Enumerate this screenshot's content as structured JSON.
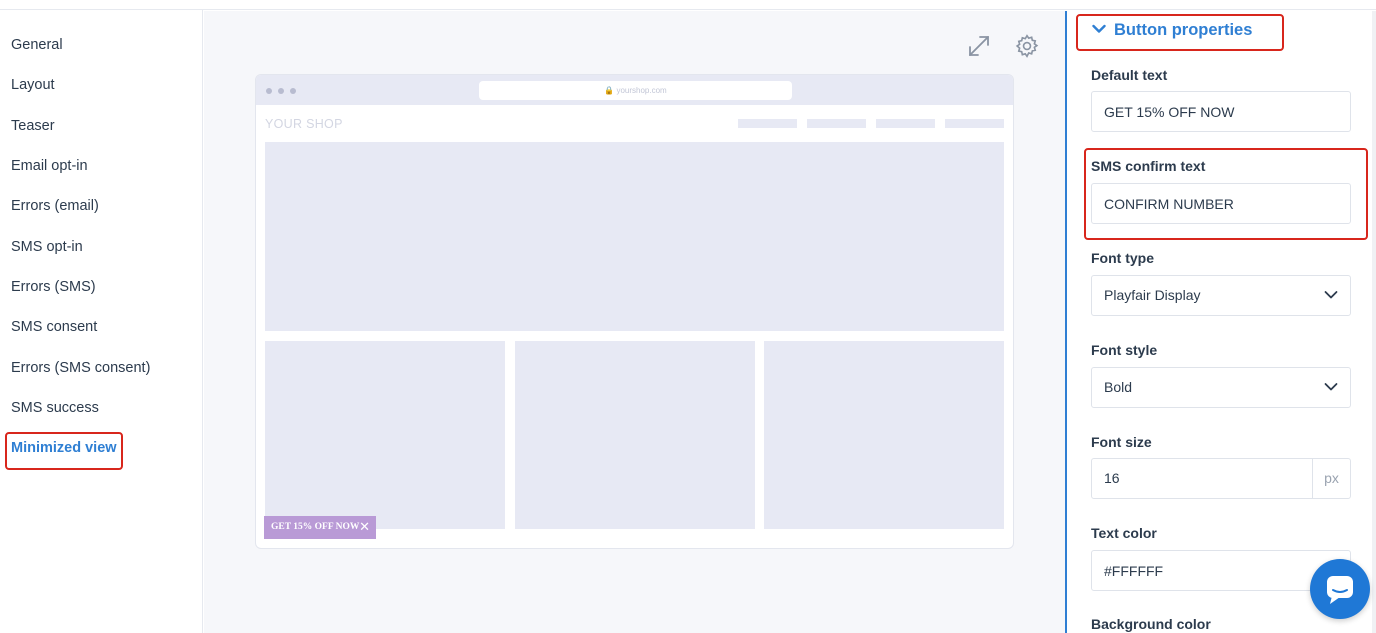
{
  "sidebar": {
    "items": [
      {
        "label": "General"
      },
      {
        "label": "Layout"
      },
      {
        "label": "Teaser"
      },
      {
        "label": "Email opt-in"
      },
      {
        "label": "Errors (email)"
      },
      {
        "label": "SMS opt-in"
      },
      {
        "label": "Errors (SMS)"
      },
      {
        "label": "SMS consent"
      },
      {
        "label": "Errors (SMS consent)"
      },
      {
        "label": "SMS success"
      },
      {
        "label": "Minimized view",
        "active": true
      }
    ]
  },
  "canvas": {
    "toolbar_icons": [
      "expand-icon",
      "gear-icon"
    ],
    "preview": {
      "url": "yourshop.com",
      "shop_name": "YOUR SHOP",
      "teaser_label": "GET 15% OFF NOW",
      "teaser_close": "✕"
    }
  },
  "panel": {
    "section_title": "Button properties",
    "fields": {
      "default_text": {
        "label": "Default text",
        "value": "GET 15% OFF NOW"
      },
      "sms_confirm_text": {
        "label": "SMS confirm text",
        "value": "CONFIRM NUMBER"
      },
      "font_type": {
        "label": "Font type",
        "value": "Playfair Display"
      },
      "font_style": {
        "label": "Font style",
        "value": "Bold"
      },
      "font_size": {
        "label": "Font size",
        "value": "16",
        "unit": "px"
      },
      "text_color": {
        "label": "Text color",
        "value": "#FFFFFF"
      },
      "background_color": {
        "label": "Background color"
      }
    }
  },
  "colors": {
    "accent": "#2f7fd3",
    "highlight": "#d8261c",
    "teaser_bg": "#b99ad6",
    "chat_button": "#1f78d6"
  },
  "chat_icon": "chat-bubble-icon"
}
